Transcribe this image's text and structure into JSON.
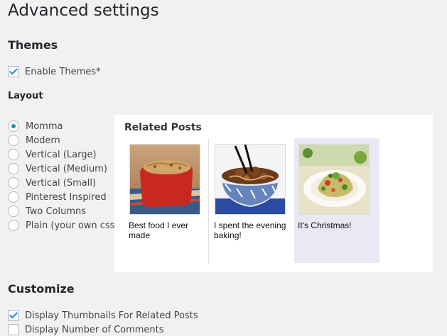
{
  "page": {
    "title": "Advanced settings"
  },
  "themes": {
    "heading": "Themes",
    "enable_label": "Enable Themes*",
    "enable_checked": true
  },
  "layout": {
    "heading": "Layout",
    "options": [
      {
        "label": "Momma",
        "checked": true
      },
      {
        "label": "Modern",
        "checked": false
      },
      {
        "label": "Vertical (Large)",
        "checked": false
      },
      {
        "label": "Vertical (Medium)",
        "checked": false
      },
      {
        "label": "Vertical (Small)",
        "checked": false
      },
      {
        "label": "Pinterest Inspired",
        "checked": false
      },
      {
        "label": "Two Columns",
        "checked": false
      },
      {
        "label": "Plain (your own css)",
        "checked": false
      }
    ]
  },
  "preview": {
    "title": "Related Posts",
    "posts": [
      {
        "caption": "Best food I ever made",
        "image": "baked-dish-thumbnail"
      },
      {
        "caption": "I spent the evening baking!",
        "image": "noodle-bowl-thumbnail"
      },
      {
        "caption": "It's Christmas!",
        "image": "salad-plate-thumbnail"
      }
    ]
  },
  "customize": {
    "heading": "Customize",
    "options": [
      {
        "label": "Display Thumbnails For Related Posts",
        "checked": true
      },
      {
        "label": "Display Number of Comments",
        "checked": false
      }
    ]
  },
  "colors": {
    "accent": "#1e8cbe",
    "background": "#f1f1f1",
    "highlight": "#e9e8f5"
  }
}
